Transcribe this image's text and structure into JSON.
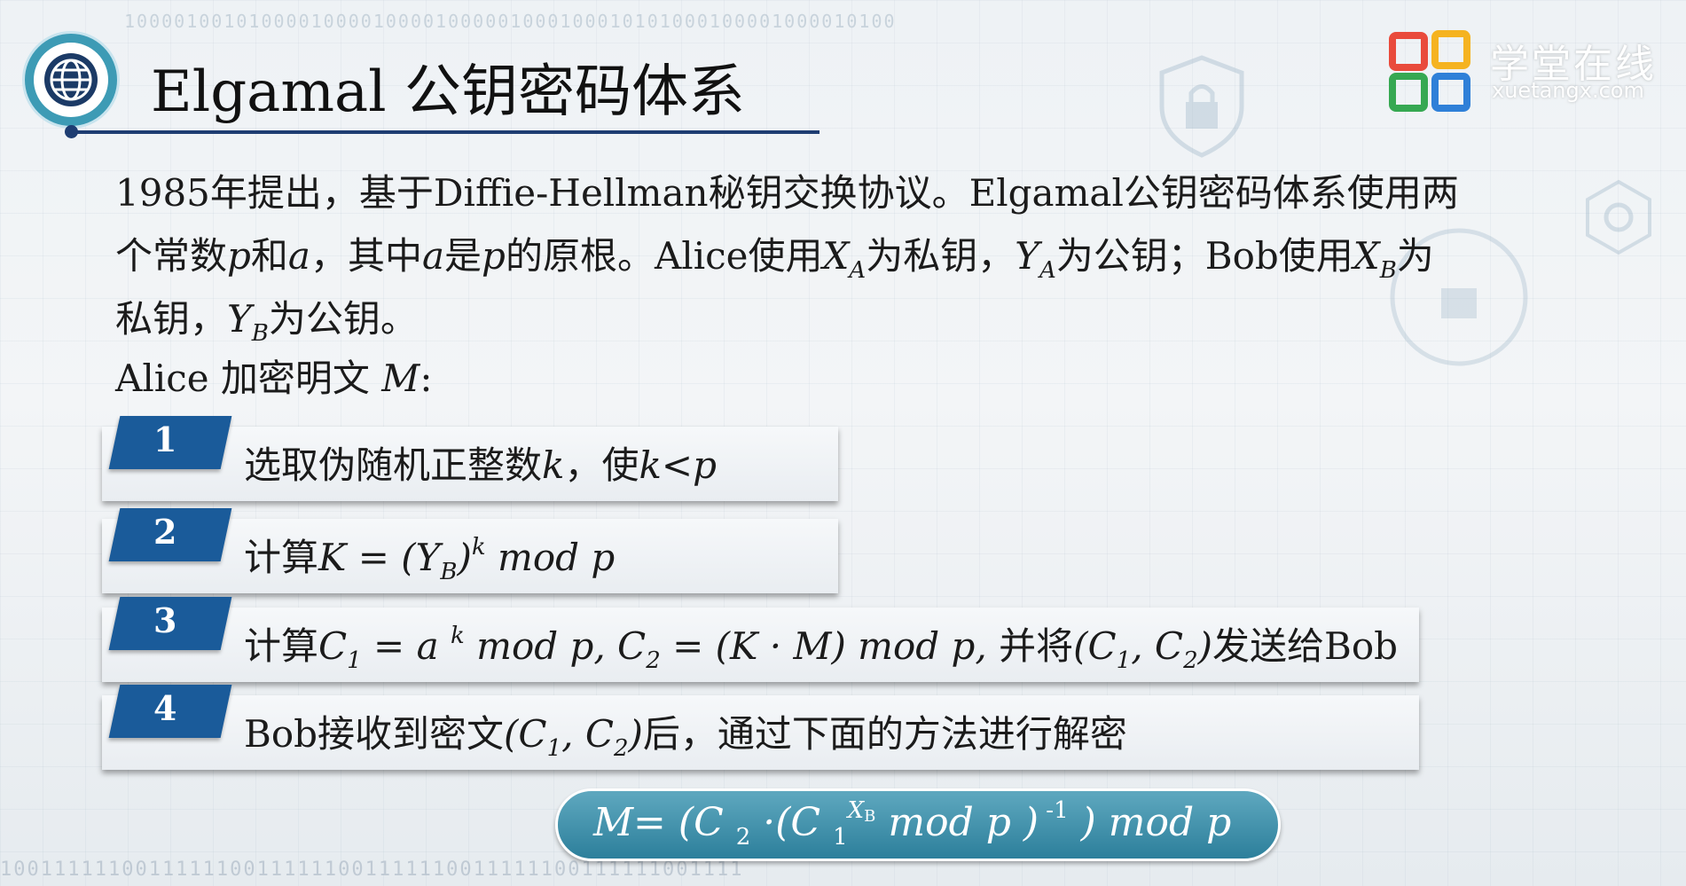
{
  "header": {
    "title": "Elgamal 公钥密码体系",
    "logo_text": "学堂在线",
    "logo_sub": "xuetangx.com"
  },
  "background": {
    "binary_top": "10000100101000010000100001000001000100010101000100001000010100",
    "binary_bottom": "1001111110011111100111111001111110011111100111111001111"
  },
  "intro": {
    "line1": "1985年提出，基于Diffie-Hellman秘钥交换协议。Elgamal公钥密码体系使用两",
    "l2_a": "个常数",
    "l2_p": "p",
    "l2_b": "和",
    "l2_alpha": "a",
    "l2_c": "，其中",
    "l2_alpha2": "a",
    "l2_d": "是",
    "l2_p2": "p",
    "l2_e": "的原根。Alice使用",
    "l2_xa": "X",
    "l2_xa_sub": "A",
    "l2_f": "为私钥，",
    "l2_ya": "Y",
    "l2_ya_sub": "A",
    "l2_g": "为公钥；Bob使用",
    "l2_xb": "X",
    "l2_xb_sub": "B",
    "l2_h": "为",
    "l3_a": "私钥，",
    "l3_yb": "Y",
    "l3_yb_sub": "B",
    "l3_b": "为公钥。"
  },
  "encrypt": {
    "label": "Alice 加密明文",
    "var": "M",
    "colon": ":"
  },
  "steps": [
    {
      "num": "1",
      "a": "选取伪随机正整数",
      "k": "k",
      "b": "，使",
      "cond": "k<p"
    },
    {
      "num": "2",
      "a": "计算",
      "K": "K = (Y",
      "sub": "B",
      "close": ")",
      "sup": "k",
      "mod": " mod p"
    },
    {
      "num": "3",
      "a": "计算",
      "c1": "C",
      "c1sub": "1",
      "eq1": " = a ",
      "sup": "k",
      "mod1": " mod p,  C",
      "c2sub": "2",
      "eq2": " = (K · M) mod p,",
      "b": " 并将",
      "pair": "(C",
      "p1": "1",
      "comma": ", C",
      "p2": "2",
      "pclose": ")",
      "c": "发送给Bob"
    },
    {
      "num": "4",
      "a": "Bob接收到密文",
      "pair": "(C",
      "p1": "1",
      "comma": ", C",
      "p2": "2",
      "pclose": ")",
      "b": "后，通过下面的方法进行解密"
    }
  ],
  "formula": {
    "m": "M=",
    "open": "  (C ",
    "c2sub": "2",
    "dot": " ·(C ",
    "c1sub": "1",
    "xb": "X",
    "xbsub": "B",
    "mod": " mod p )",
    "inv": " -1",
    "close": " )  mod p"
  }
}
